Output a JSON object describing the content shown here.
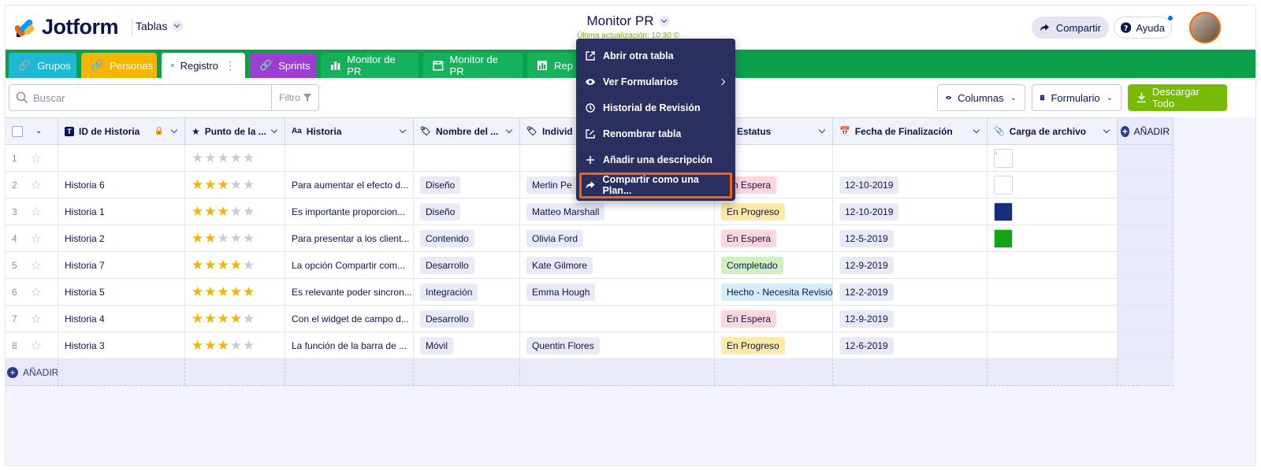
{
  "header": {
    "logo_text": "Jotform",
    "tables_label": "Tablas",
    "title": "Monitor PR",
    "subtitle": "Última actualización: 10:30 ©",
    "share_label": "Compartir",
    "help_label": "Ayuda"
  },
  "tabs": [
    {
      "label": "Grupos",
      "color": "#1cb8d4"
    },
    {
      "label": "Personas",
      "color": "#f5b400"
    },
    {
      "label": "Registro",
      "color": "#ffffff"
    },
    {
      "label": "Sprints",
      "color": "#9a3fd1"
    },
    {
      "label": "Monitor de PR",
      "color": "#17b15b"
    },
    {
      "label": "Monitor de PR",
      "color": "#17b15b"
    },
    {
      "label": "Rep",
      "color": "#17b15b"
    }
  ],
  "toolbar": {
    "search_placeholder": "Buscar",
    "filter_label": "Filtro",
    "columns_label": "Columnas",
    "form_label": "Formulario",
    "download_label": "Descargar Todo"
  },
  "columns": [
    {
      "label": "ID de Historia"
    },
    {
      "label": "Punto de la ..."
    },
    {
      "label": "Historia"
    },
    {
      "label": "Nombre del ..."
    },
    {
      "label": "Individ"
    },
    {
      "label": "Estatus"
    },
    {
      "label": "Fecha de Finalización"
    },
    {
      "label": "Carga de archivo"
    }
  ],
  "add_label": "AÑADIR",
  "rows": [
    {
      "n": "1",
      "id": "",
      "stars": 0,
      "story": "",
      "name": "",
      "person": "",
      "status": "",
      "status_color": "",
      "date": "",
      "file": "broken"
    },
    {
      "n": "2",
      "id": "Historia 6",
      "stars": 3,
      "story": "Para aumentar el efecto d...",
      "name": "Diseño",
      "person": "Merlin Pe",
      "status": "En Espera",
      "status_color": "#ffd6dc",
      "date": "12-10-2019",
      "file": "white"
    },
    {
      "n": "3",
      "id": "Historia 1",
      "stars": 3,
      "story": "Es importante proporcion...",
      "name": "Diseño",
      "person": "Matteo Marshall",
      "status": "En Progreso",
      "status_color": "#ffe9a8",
      "date": "12-10-2019",
      "file": "navy"
    },
    {
      "n": "4",
      "id": "Historia 2",
      "stars": 2,
      "story": "Para presentar a los client...",
      "name": "Contenido",
      "person": "Olivia Ford",
      "status": "En Espera",
      "status_color": "#ffd6dc",
      "date": "12-5-2019",
      "file": "green"
    },
    {
      "n": "5",
      "id": "Historia 7",
      "stars": 4,
      "story": "La opción Compartir com...",
      "name": "Desarrollo",
      "person": "Kate Gilmore",
      "status": "Completado",
      "status_color": "#d0f0c0",
      "date": "12-9-2019",
      "file": ""
    },
    {
      "n": "6",
      "id": "Historia 5",
      "stars": 5,
      "story": "Es relevante poder sincron...",
      "name": "Integración",
      "person": "Emma Hough",
      "status": "Hecho - Necesita Revisió",
      "status_color": "#d4eefc",
      "date": "12-2-2019",
      "file": ""
    },
    {
      "n": "7",
      "id": "Historia 4",
      "stars": 4,
      "story": "Con el widget de campo d...",
      "name": "Desarrollo",
      "person": "",
      "status": "En Espera",
      "status_color": "#ffd6dc",
      "date": "12-9-2019",
      "file": ""
    },
    {
      "n": "8",
      "id": "Historia 3",
      "stars": 3,
      "story": "La función de la barra de ...",
      "name": "Móvil",
      "person": "Quentin Flores",
      "status": "En Progreso",
      "status_color": "#ffe9a8",
      "date": "12-6-2019",
      "file": ""
    }
  ],
  "menu": {
    "items": [
      {
        "label": "Abrir otra tabla",
        "icon": "external-link-icon"
      },
      {
        "label": "Ver Formularios",
        "icon": "eye-icon"
      },
      {
        "label": "Historial de Revisión",
        "icon": "clock-icon"
      },
      {
        "label": "Renombrar tabla",
        "icon": "edit-icon"
      },
      {
        "label": "Añadir una descripción",
        "icon": "plus-icon"
      },
      {
        "label": "Compartir como una Plan...",
        "icon": "share-icon"
      }
    ]
  },
  "colors": {
    "accent": "#ff6100",
    "tabbar": "#0ba14a",
    "download": "#78bb07",
    "menu_bg": "#2b2f5f"
  }
}
